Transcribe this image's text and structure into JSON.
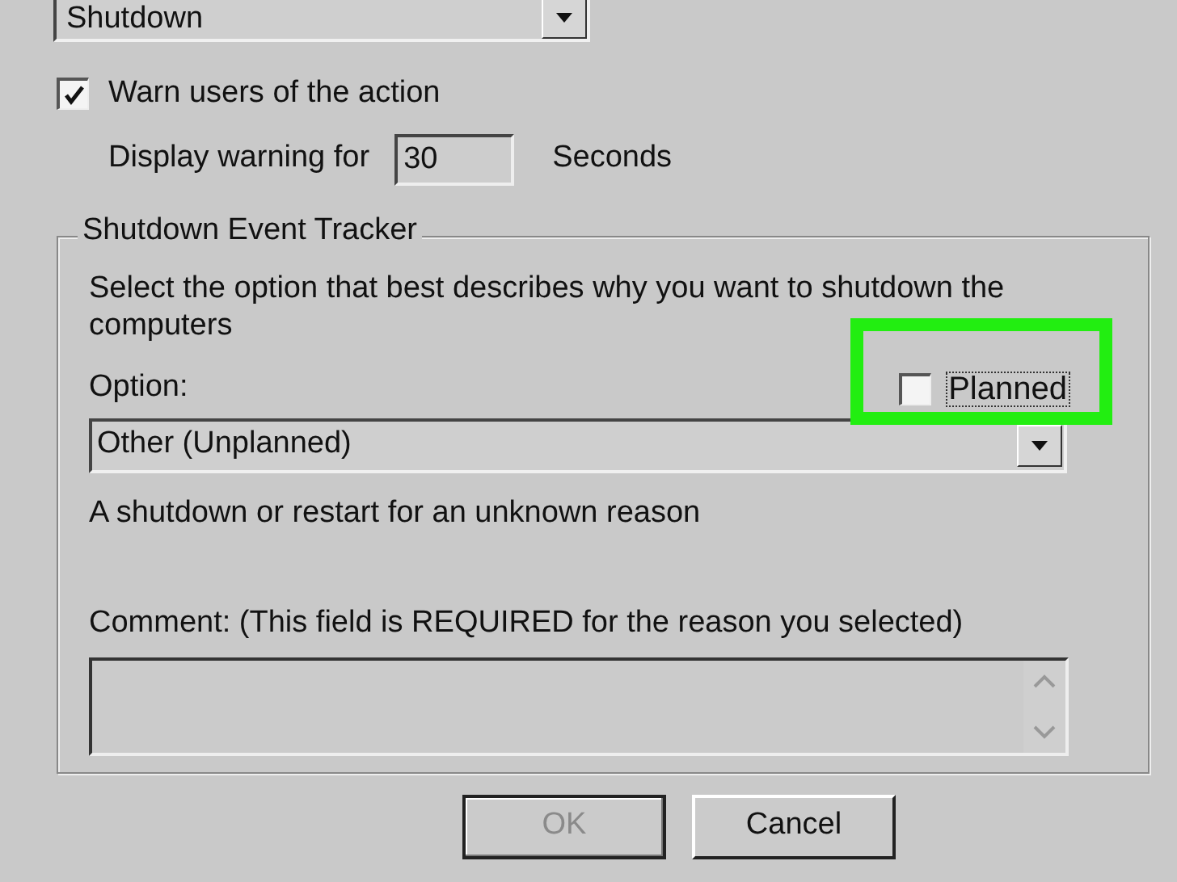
{
  "action_dropdown": {
    "value": "Shutdown"
  },
  "warn_checkbox": {
    "label": "Warn users of the action",
    "checked": true
  },
  "warning_delay": {
    "label": "Display warning for",
    "value": "30",
    "unit": "Seconds"
  },
  "event_tracker": {
    "title": "Shutdown Event Tracker",
    "instructions": "Select the option that best describes why you want to shutdown the computers",
    "option_label": "Option:",
    "planned_checkbox": {
      "label": "Planned",
      "checked": false,
      "highlighted": true
    },
    "option_dropdown": {
      "value": "Other (Unplanned)"
    },
    "description": "A shutdown or restart for an unknown reason",
    "comment_label": "Comment: (This field is REQUIRED for the reason you selected)"
  },
  "buttons": [
    {
      "label": "OK",
      "disabled": true
    },
    {
      "label": "Cancel",
      "disabled": false
    }
  ]
}
